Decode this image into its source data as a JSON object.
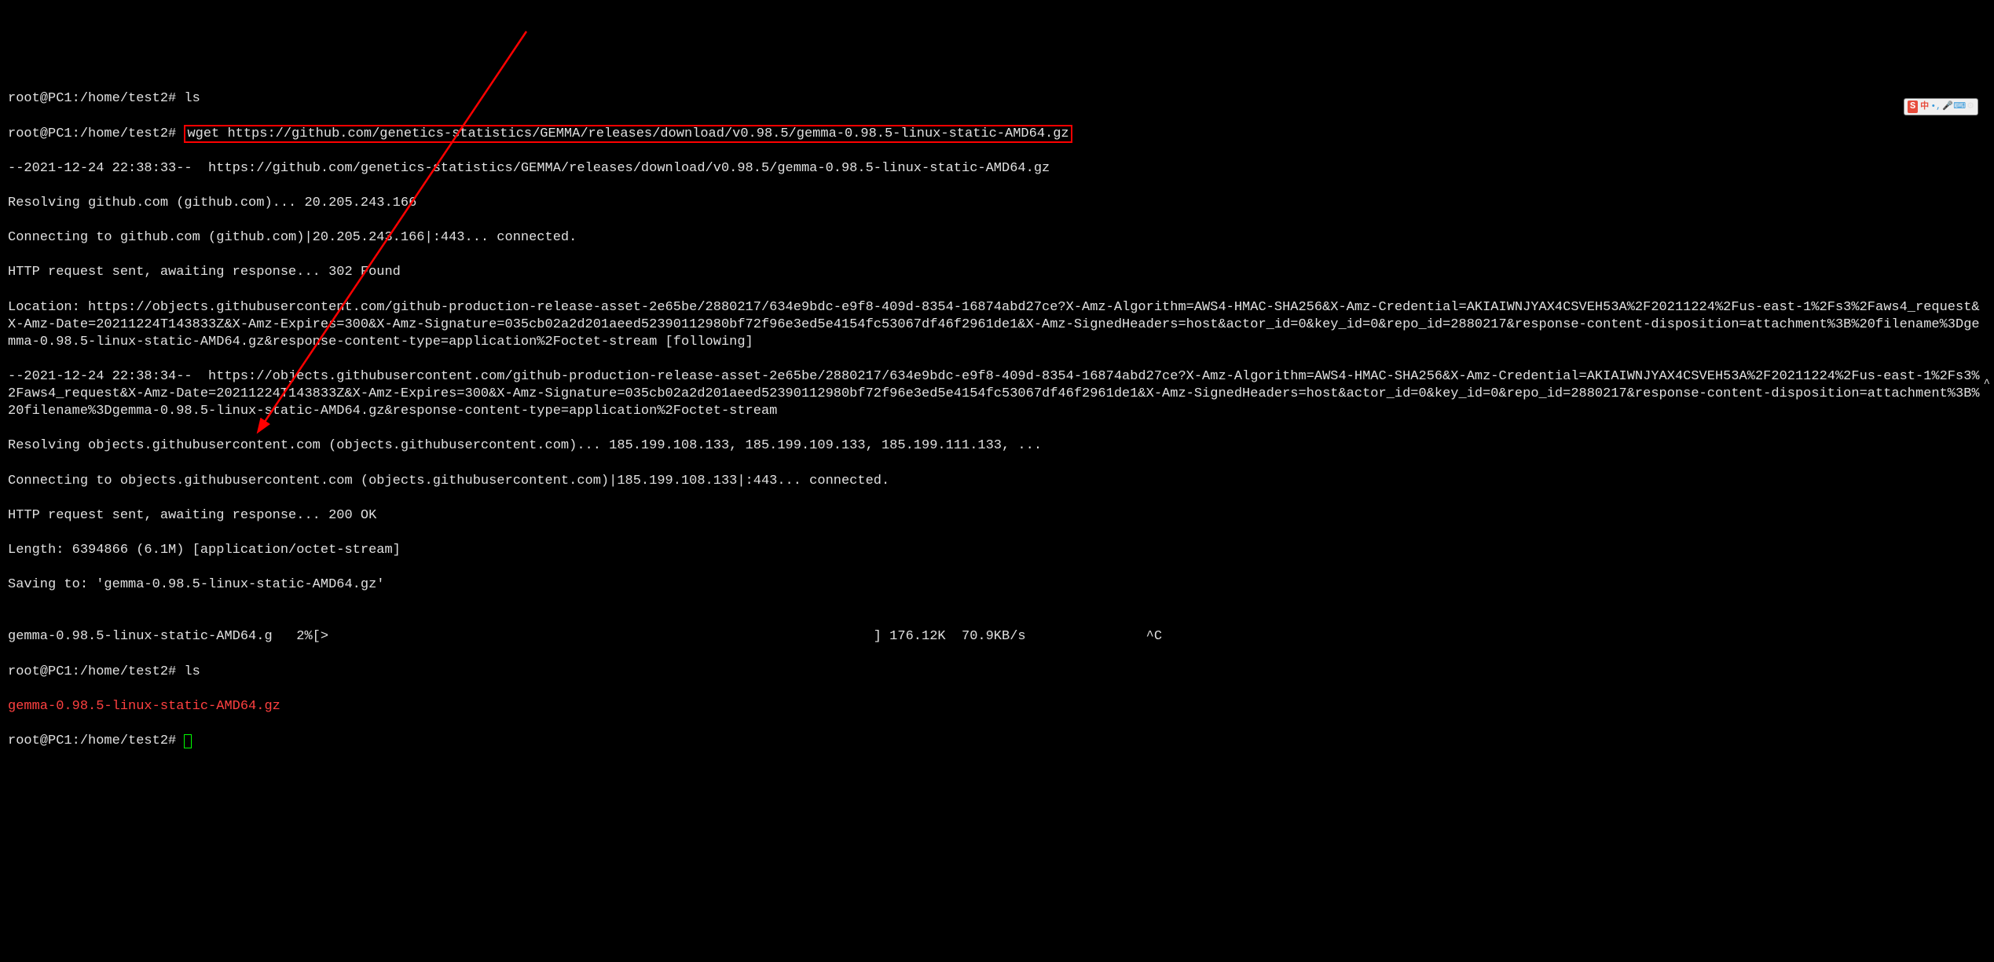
{
  "terminal": {
    "line0": "root@PC1:/home/test2# ls",
    "prompt1": "root@PC1:/home/test2# ",
    "command1": "wget https://github.com/genetics-statistics/GEMMA/releases/download/v0.98.5/gemma-0.98.5-linux-static-AMD64.gz",
    "line2": "--2021-12-24 22:38:33--  https://github.com/genetics-statistics/GEMMA/releases/download/v0.98.5/gemma-0.98.5-linux-static-AMD64.gz",
    "line3": "Resolving github.com (github.com)... 20.205.243.166",
    "line4": "Connecting to github.com (github.com)|20.205.243.166|:443... connected.",
    "line5": "HTTP request sent, awaiting response... 302 Found",
    "line6": "Location: https://objects.githubusercontent.com/github-production-release-asset-2e65be/2880217/634e9bdc-e9f8-409d-8354-16874abd27ce?X-Amz-Algorithm=AWS4-HMAC-SHA256&X-Amz-Credential=AKIAIWNJYAX4CSVEH53A%2F20211224%2Fus-east-1%2Fs3%2Faws4_request&X-Amz-Date=20211224T143833Z&X-Amz-Expires=300&X-Amz-Signature=035cb02a2d201aeed52390112980bf72f96e3ed5e4154fc53067df46f2961de1&X-Amz-SignedHeaders=host&actor_id=0&key_id=0&repo_id=2880217&response-content-disposition=attachment%3B%20filename%3Dgemma-0.98.5-linux-static-AMD64.gz&response-content-type=application%2Foctet-stream [following]",
    "line7": "--2021-12-24 22:38:34--  https://objects.githubusercontent.com/github-production-release-asset-2e65be/2880217/634e9bdc-e9f8-409d-8354-16874abd27ce?X-Amz-Algorithm=AWS4-HMAC-SHA256&X-Amz-Credential=AKIAIWNJYAX4CSVEH53A%2F20211224%2Fus-east-1%2Fs3%2Faws4_request&X-Amz-Date=20211224T143833Z&X-Amz-Expires=300&X-Amz-Signature=035cb02a2d201aeed52390112980bf72f96e3ed5e4154fc53067df46f2961de1&X-Amz-SignedHeaders=host&actor_id=0&key_id=0&repo_id=2880217&response-content-disposition=attachment%3B%20filename%3Dgemma-0.98.5-linux-static-AMD64.gz&response-content-type=application%2Foctet-stream",
    "line8": "Resolving objects.githubusercontent.com (objects.githubusercontent.com)... 185.199.108.133, 185.199.109.133, 185.199.111.133, ...",
    "line9": "Connecting to objects.githubusercontent.com (objects.githubusercontent.com)|185.199.108.133|:443... connected.",
    "line10": "HTTP request sent, awaiting response... 200 OK",
    "line11": "Length: 6394866 (6.1M) [application/octet-stream]",
    "line12": "Saving to: 'gemma-0.98.5-linux-static-AMD64.gz'",
    "line13": "",
    "line14": "gemma-0.98.5-linux-static-AMD64.g   2%[>                                                                    ] 176.12K  70.9KB/s               ^C",
    "line15": "root@PC1:/home/test2# ls",
    "line16": "gemma-0.98.5-linux-static-AMD64.gz",
    "prompt17": "root@PC1:/home/test2# "
  },
  "ime": {
    "s": "S",
    "cn": "中"
  },
  "scroll": "^"
}
